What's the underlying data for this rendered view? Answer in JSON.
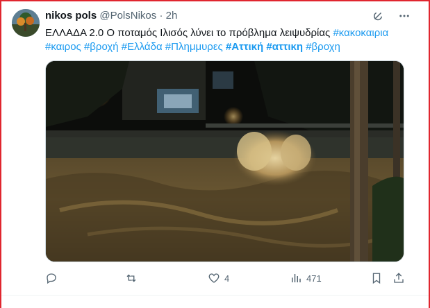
{
  "tweet": {
    "author_name": "nikos pols",
    "author_handle": "@PolsNikos",
    "separator": "·",
    "time": "2h",
    "text_main": "ΕΛΛΑΔΑ 2.0 Ο ποταμός Ιλισός λύνει το πρόβλημα λειψυδρίας",
    "hashtags": [
      "#κακοκαιρια",
      "#καιρος",
      "#βροχή",
      "#Ελλάδα",
      "#Πλημμυρες",
      "#Αττική",
      "#αττικη",
      "#βροχη"
    ],
    "bold_hashtags": [
      "#Αττική",
      "#αττικη"
    ]
  },
  "header_icons": [
    "grok-icon",
    "more-icon"
  ],
  "actions": {
    "reply": {
      "icon": "reply-icon",
      "count": ""
    },
    "retweet": {
      "icon": "retweet-icon",
      "count": ""
    },
    "like": {
      "icon": "heart-icon",
      "count": "4"
    },
    "views": {
      "icon": "views-icon",
      "count": "471"
    },
    "bookmark": {
      "icon": "bookmark-icon"
    },
    "share": {
      "icon": "share-icon"
    }
  },
  "colors": {
    "accent": "#1d9bf0",
    "text": "#0f1419",
    "muted": "#536471",
    "frame": "#e0262f"
  }
}
